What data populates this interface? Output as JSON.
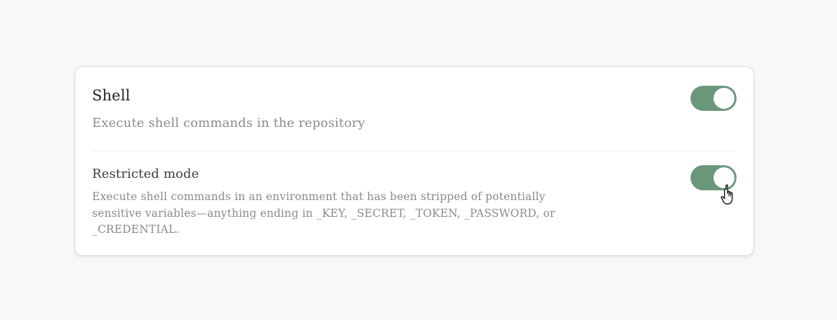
{
  "settings": {
    "shell": {
      "title": "Shell",
      "description": "Execute shell commands in the repository",
      "enabled": true
    },
    "restricted": {
      "title": "Restricted mode",
      "description": "Execute shell commands in an environment that has been stripped of potentially sensitive variables—anything ending in _KEY, _SECRET, _TOKEN, _PASSWORD, or _CREDENTIAL.",
      "enabled": true
    }
  },
  "colors": {
    "toggle_on": "#6a977a",
    "background": "#f8f8f8",
    "card": "#ffffff"
  },
  "icons": {
    "cursor": "hand-pointer-icon"
  }
}
